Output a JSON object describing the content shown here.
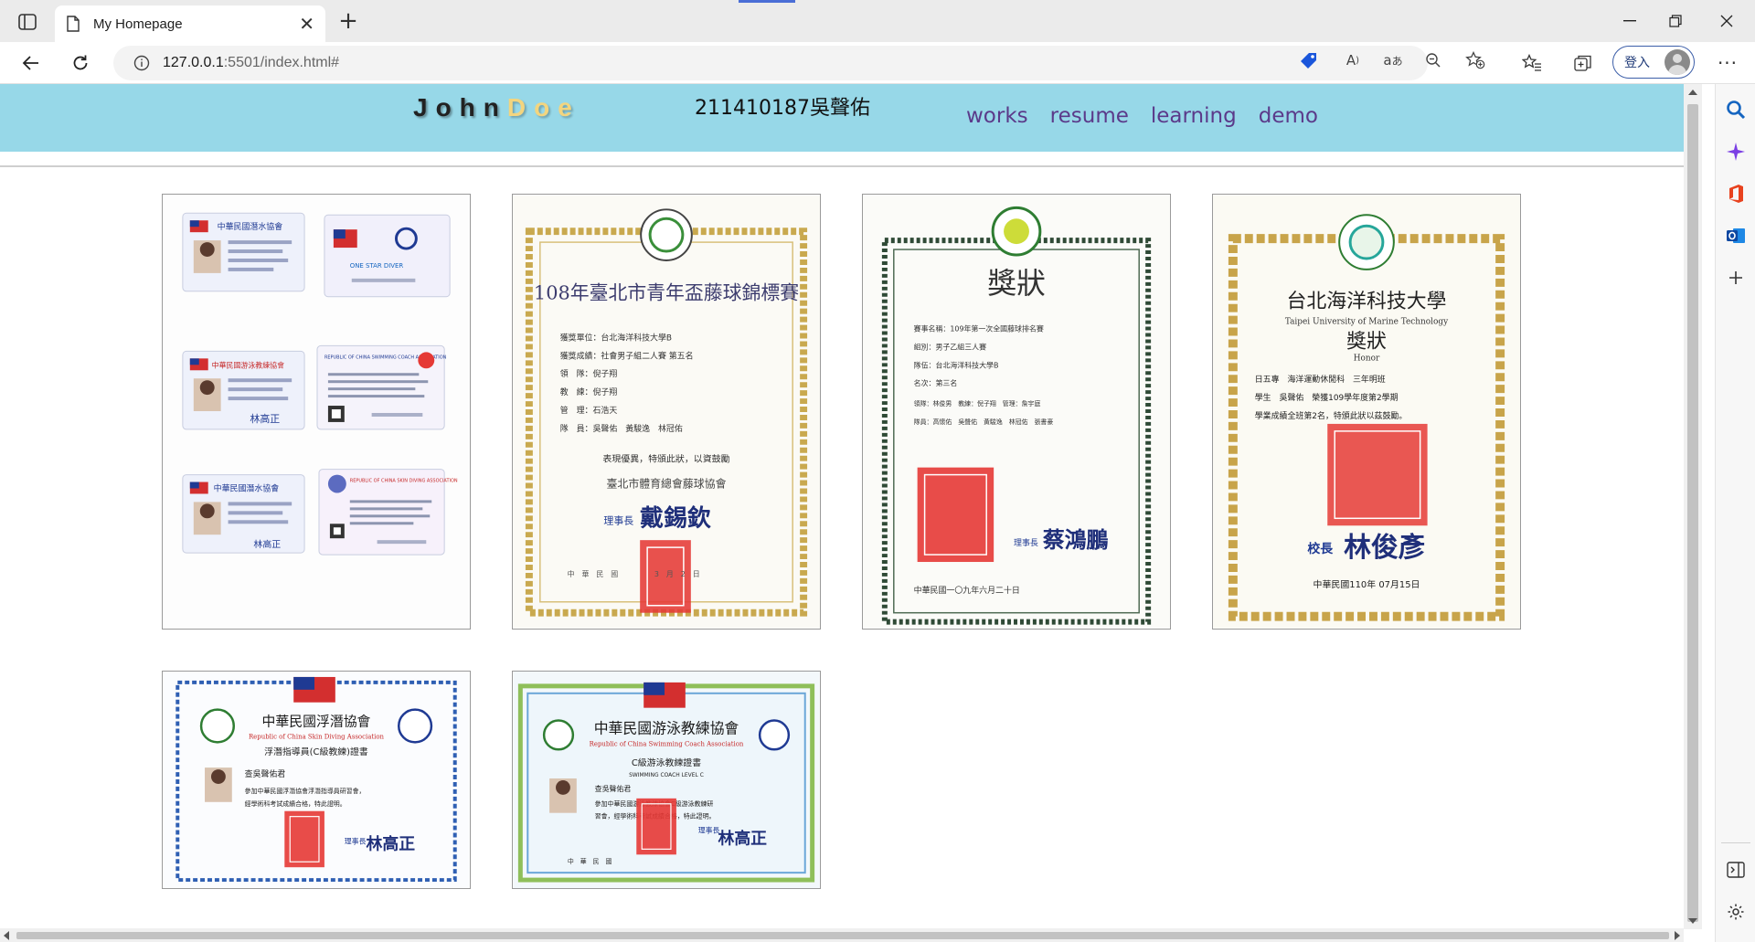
{
  "browser": {
    "tab_title": "My Homepage",
    "url_host": "127.0.0.1",
    "url_rest": ":5501/index.html#",
    "signin_label": "登入"
  },
  "site": {
    "logo_part1": "John",
    "logo_part2": "Doe",
    "student_id": "211410187吳聲佑",
    "nav": [
      "works",
      "resume",
      "learning",
      "demo"
    ]
  },
  "certificates": {
    "card1": {
      "items": [
        "中華民國潛水協會",
        "ONE STAR DIVER",
        "中華民國游泳教練協會",
        "REPUBLIC OF CHINA SWIMMING COACH ASSOCIATION",
        "中華民國潛水協會",
        "REPUBLIC OF CHINA SKIN DIVING ASSOCIATION"
      ],
      "signature": "林高正"
    },
    "card2": {
      "title": "108年臺北市青年盃藤球錦標賽",
      "lines": [
        "獲獎單位：台北海洋科技大學B",
        "獲獎成績：社會男子組二人賽 第五名",
        "領　隊：倪子翔",
        "教　練：倪子翔",
        "管　理：石浩天",
        "隊　員：吳聲佑　黃駿逸　林冠佑"
      ],
      "closing": "表現優異，特頒此狀，以資鼓勵",
      "org": "臺北市體育總會藤球協會",
      "signer_title": "理事長",
      "signer": "戴錫欽",
      "date": "中　華　民　國　　　　　3　月　2　日"
    },
    "card3": {
      "title": "獎狀",
      "lines": [
        "賽事名稱：109年第一次全國藤球排名賽",
        "組別：男子乙組三人賽",
        "隊伍：台北海洋科技大學B",
        "名次：第三名",
        "領隊：林俊男　教練：倪子翔　管理：詹宇庭",
        "隊員：高懷佑　吳聲佑　黃駿逸　林冠佑　張書豪"
      ],
      "signer_title": "理事長",
      "signer": "蔡鴻鵬",
      "date": "中華民國一〇九年六月二十日"
    },
    "card4": {
      "school": "台北海洋科技大學",
      "school_en": "Taipei University of Marine Technology",
      "title": "獎狀",
      "title_en": "Honor",
      "lines": [
        "日五專　海洋運動休閒科　三年明班",
        "學生　吳聲佑　榮獲109學年度第2學期",
        "學業成績全班第2名，特頒此狀以茲鼓勵。"
      ],
      "signer_title": "校長",
      "signer": "林俊彥",
      "date": "中華民國110年 07月15日"
    },
    "card5": {
      "org": "中華民國浮潛協會",
      "org_en": "Republic of China Skin Diving Association",
      "title": "浮潛指導員(C級教練)證書",
      "holder": "查吳聲佑君",
      "lines": [
        "參加中華民國浮潛協會浮潛指導員研習會，",
        "經學術科考試成績合格，特此證明。"
      ],
      "signer_title": "理事長",
      "signer": "林高正"
    },
    "card6": {
      "org": "中華民國游泳教練協會",
      "org_en": "Republic of China Swimming Coach Association",
      "title": "C級游泳教練證書",
      "title_en": "SWIMMING COACH LEVEL C",
      "holder": "查吳聲佑君",
      "lines": [
        "參加中華民國游泳教練協會C級游泳教練研",
        "習會，經學術科考試成績合格，特此證明。"
      ],
      "signer_title": "理事長",
      "signer": "林高正",
      "date": "中　華　民　國"
    }
  }
}
